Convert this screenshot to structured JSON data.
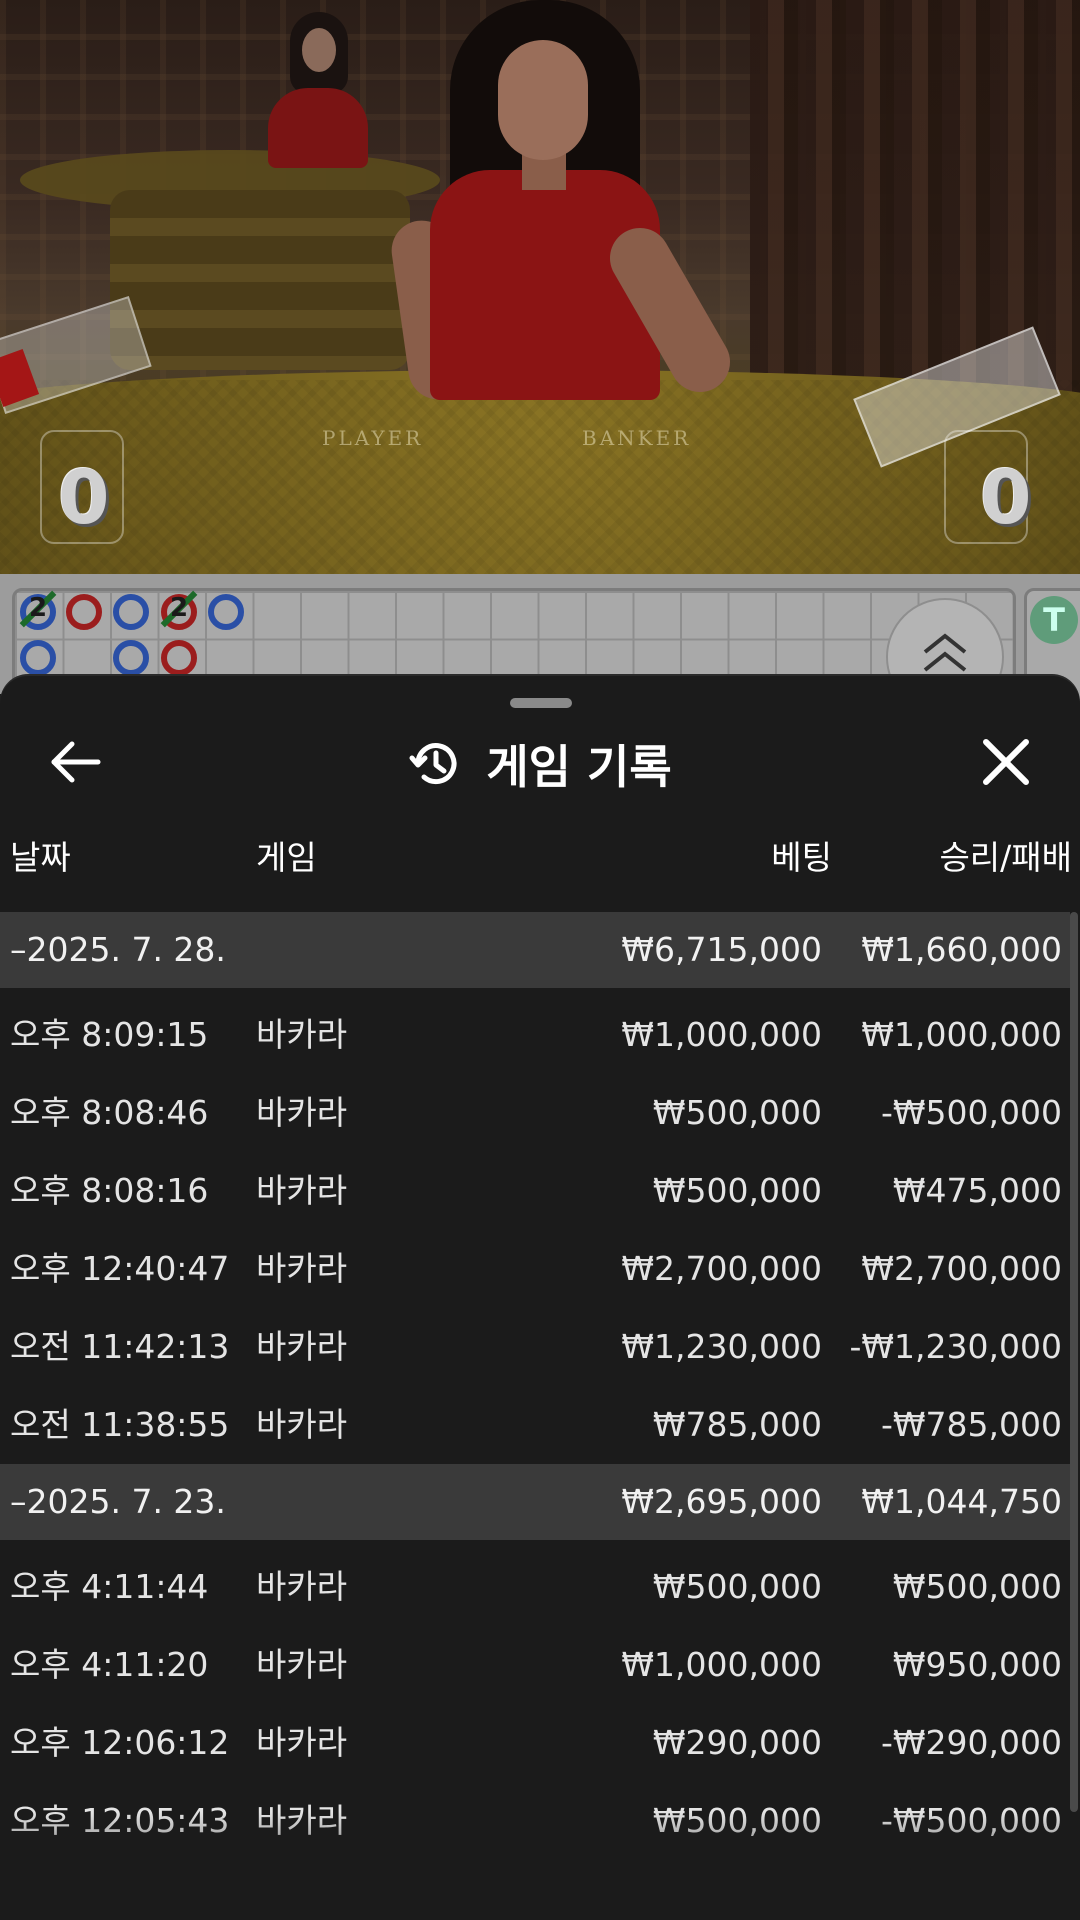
{
  "video": {
    "table_labels": {
      "player": "PLAYER",
      "banker": "BANKER"
    },
    "player_score": "0",
    "banker_score": "0"
  },
  "roadmap": {
    "beads_row1": [
      {
        "color": "blue",
        "number": "2",
        "tie_slash": true
      },
      {
        "color": "red",
        "number": "",
        "tie_slash": false
      },
      {
        "color": "blue",
        "number": "",
        "tie_slash": false
      },
      {
        "color": "red",
        "number": "2",
        "tie_slash": true
      },
      {
        "color": "blue",
        "number": "",
        "tie_slash": false
      }
    ],
    "beads_row2": [
      {
        "color": "blue"
      },
      {
        "color": "blue"
      },
      {
        "color": "red"
      }
    ],
    "side_label": "T"
  },
  "sheet": {
    "title": "게임 기록",
    "icons": {
      "back": "arrow-left-icon",
      "history": "history-icon",
      "close": "close-icon",
      "expand": "chevron-up-double-icon"
    },
    "columns": {
      "date": "날짜",
      "game": "게임",
      "bet": "베팅",
      "win_loss": "승리/패배"
    },
    "groups": [
      {
        "date": "–2025. 7. 28.",
        "bet_total": "₩6,715,000",
        "win_total": "₩1,660,000",
        "rows": [
          {
            "time": "오후 8:09:15",
            "game": "바카라",
            "bet": "₩1,000,000",
            "result": "₩1,000,000"
          },
          {
            "time": "오후 8:08:46",
            "game": "바카라",
            "bet": "₩500,000",
            "result": "-₩500,000"
          },
          {
            "time": "오후 8:08:16",
            "game": "바카라",
            "bet": "₩500,000",
            "result": "₩475,000"
          },
          {
            "time": "오후 12:40:47",
            "game": "바카라",
            "bet": "₩2,700,000",
            "result": "₩2,700,000"
          },
          {
            "time": "오전 11:42:13",
            "game": "바카라",
            "bet": "₩1,230,000",
            "result": "-₩1,230,000"
          },
          {
            "time": "오전 11:38:55",
            "game": "바카라",
            "bet": "₩785,000",
            "result": "-₩785,000"
          }
        ]
      },
      {
        "date": "–2025. 7. 23.",
        "bet_total": "₩2,695,000",
        "win_total": "₩1,044,750",
        "rows": [
          {
            "time": "오후 4:11:44",
            "game": "바카라",
            "bet": "₩500,000",
            "result": "₩500,000"
          },
          {
            "time": "오후 4:11:20",
            "game": "바카라",
            "bet": "₩1,000,000",
            "result": "₩950,000"
          },
          {
            "time": "오후 12:06:12",
            "game": "바카라",
            "bet": "₩290,000",
            "result": "-₩290,000"
          },
          {
            "time": "오후 12:05:43",
            "game": "바카라",
            "bet": "₩500,000",
            "result": "-₩500,000"
          }
        ]
      }
    ]
  }
}
